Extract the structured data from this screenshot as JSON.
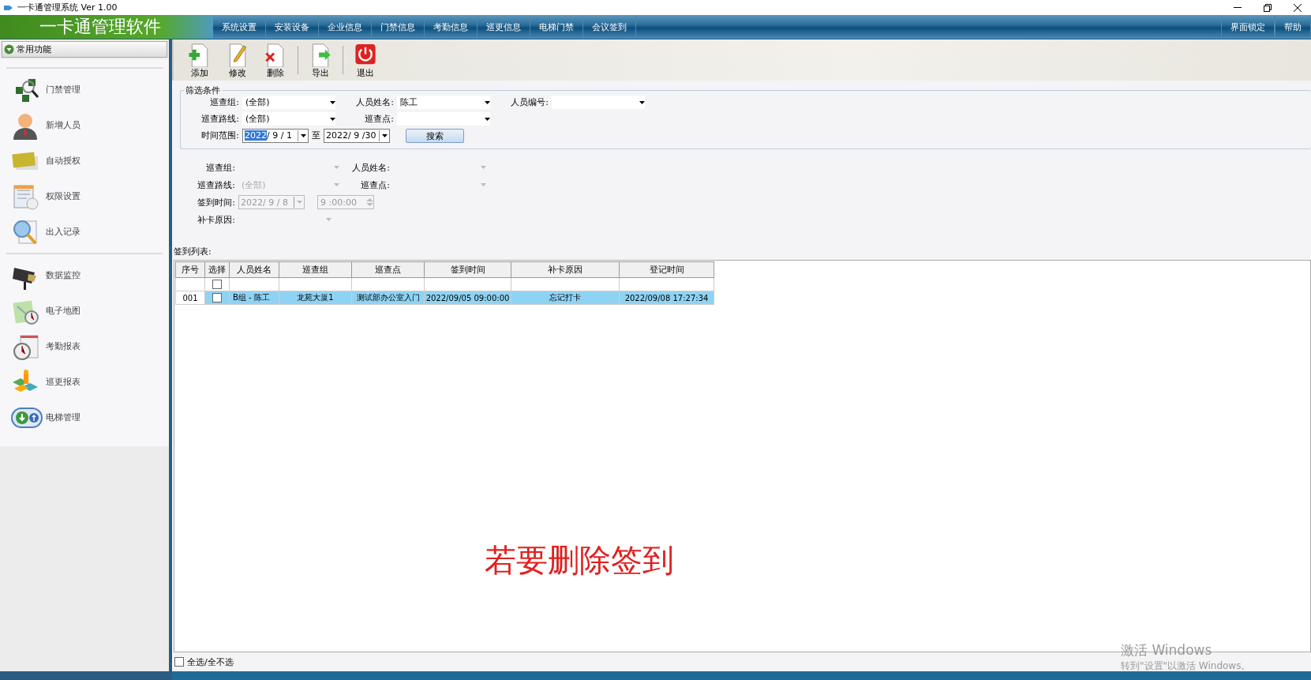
{
  "window": {
    "title": "一卡通管理系统  Ver 1.00"
  },
  "app_title": "一卡通管理软件",
  "menu": [
    {
      "label": "系统设置"
    },
    {
      "label": "安装设备"
    },
    {
      "label": "企业信息"
    },
    {
      "label": "门禁信息"
    },
    {
      "label": "考勤信息"
    },
    {
      "label": "巡更信息"
    },
    {
      "label": "电梯门禁"
    },
    {
      "label": "会议签到"
    }
  ],
  "menu_right": [
    {
      "label": "界面锁定"
    },
    {
      "label": "帮助"
    }
  ],
  "sidebar": {
    "header": "常用功能",
    "groups": [
      [
        {
          "label": "门禁管理",
          "kind": "chips"
        },
        {
          "label": "新增人员",
          "kind": "person"
        },
        {
          "label": "自动授权",
          "kind": "cards"
        },
        {
          "label": "权限设置",
          "kind": "doc"
        },
        {
          "label": "出入记录",
          "kind": "magnifier"
        }
      ],
      [
        {
          "label": "数据监控",
          "kind": "camera"
        },
        {
          "label": "电子地图",
          "kind": "map"
        },
        {
          "label": "考勤报表",
          "kind": "clock"
        },
        {
          "label": "巡更报表",
          "kind": "blocks"
        },
        {
          "label": "电梯管理",
          "kind": "elevator"
        }
      ]
    ]
  },
  "toolbar": [
    {
      "label": "添加",
      "kind": "add"
    },
    {
      "label": "修改",
      "kind": "edit"
    },
    {
      "label": "删除",
      "kind": "delete"
    },
    {
      "label": "导出",
      "kind": "export"
    },
    {
      "label": "退出",
      "kind": "exit"
    }
  ],
  "filter": {
    "title": "筛选条件",
    "rows": [
      [
        {
          "kind": "combo",
          "label": "巡查组:",
          "value": "(全部)"
        },
        {
          "kind": "combo",
          "label": "人员姓名:",
          "value": "陈工"
        },
        {
          "kind": "combo",
          "label": "人员编号:"
        }
      ],
      [
        {
          "kind": "combo",
          "label": "巡查路线:",
          "value": "(全部)"
        },
        {
          "kind": "combo",
          "label": "巡查点:"
        }
      ],
      [
        {
          "kind": "date",
          "label": "时间范围:",
          "selected_part": "2022",
          "value": "/ 9 / 1"
        },
        {
          "kind": "sep",
          "label": "至"
        },
        {
          "kind": "date",
          "value": "2022/ 9 /30"
        },
        {
          "kind": "button",
          "label": "搜索"
        }
      ]
    ]
  },
  "edit_form": {
    "disabled": true,
    "rows": [
      [
        {
          "kind": "combo",
          "label": "巡查组:"
        },
        {
          "kind": "combo",
          "label": "人员姓名:"
        }
      ],
      [
        {
          "kind": "combo",
          "label": "巡查路线:",
          "value": "(全部)"
        },
        {
          "kind": "combo",
          "label": "巡查点:"
        }
      ],
      [
        {
          "kind": "date",
          "label": "签到时间:",
          "value": "2022/ 9 / 8"
        },
        {
          "kind": "time",
          "value": "9 :00:00"
        }
      ],
      [
        {
          "kind": "combo",
          "label": "补卡原因:"
        }
      ]
    ]
  },
  "table": {
    "label": "签到列表:",
    "columns": [
      "序号",
      "选择",
      "人员姓名",
      "巡查组",
      "巡查点",
      "签到时间",
      "补卡原因",
      "登记时间"
    ],
    "rows": [
      {
        "cells": [
          "",
          "",
          "",
          "",
          "",
          "",
          "",
          ""
        ],
        "checked": false,
        "selected": false
      },
      {
        "cells": [
          "001",
          "",
          "B组 - 陈工",
          "龙苑大厦1",
          "测试部办公室入门",
          "2022/09/05 09:00:00",
          "忘记打卡",
          "2022/09/08 17:27:34"
        ],
        "checked": false,
        "selected": true
      }
    ]
  },
  "select_all": {
    "label": "全选/全不选",
    "checked": false
  },
  "caption": "若要删除签到",
  "activation": {
    "title": "激活 Windows",
    "hint": "转到\"设置\"以激活 Windows。"
  }
}
